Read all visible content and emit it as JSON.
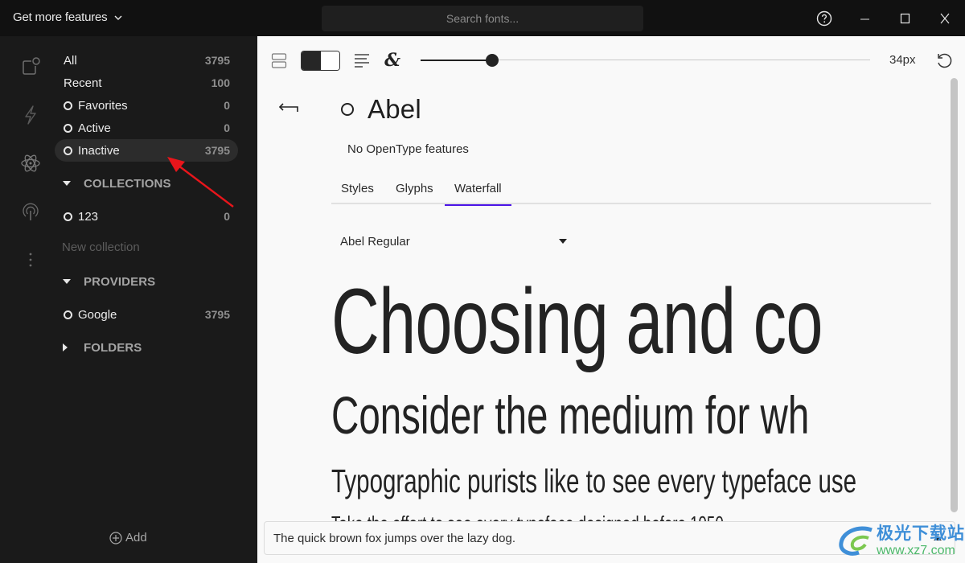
{
  "titlebar": {
    "features_label": "Get more features",
    "search_placeholder": "Search fonts...",
    "help_icon": "question-circle-icon",
    "minimize_icon": "minimize-icon",
    "maximize_icon": "maximize-icon",
    "close_icon": "close-icon"
  },
  "rail": {
    "items": [
      {
        "icon": "shapes-icon"
      },
      {
        "icon": "lightning-icon"
      },
      {
        "icon": "atom-icon"
      },
      {
        "icon": "broadcast-icon"
      },
      {
        "icon": "more-vertical-icon"
      }
    ]
  },
  "sidebar": {
    "library": [
      {
        "label": "All",
        "count": "3795",
        "has_ring": false
      },
      {
        "label": "Recent",
        "count": "100",
        "has_ring": false
      },
      {
        "label": "Favorites",
        "count": "0",
        "has_ring": true
      },
      {
        "label": "Active",
        "count": "0",
        "has_ring": true
      },
      {
        "label": "Inactive",
        "count": "3795",
        "has_ring": true,
        "selected": true
      }
    ],
    "collections": {
      "header": "COLLECTIONS",
      "expanded": true,
      "items": [
        {
          "label": "123",
          "count": "0"
        }
      ],
      "new_placeholder": "New collection"
    },
    "providers": {
      "header": "PROVIDERS",
      "expanded": true,
      "items": [
        {
          "label": "Google",
          "count": "3795"
        }
      ]
    },
    "folders": {
      "header": "FOLDERS",
      "expanded": false
    },
    "add_label": "Add"
  },
  "toolbar": {
    "layout_icon": "layout-rows-icon",
    "theme_toggle": "dark-light-toggle",
    "align_icon": "align-left-icon",
    "opentype_icon": "ampersand-icon",
    "size_slider_fraction": 0.16,
    "size_readout": "34px",
    "reset_icon": "reset-icon"
  },
  "font": {
    "name": "Abel",
    "opentype_note": "No OpenType features",
    "tabs": [
      {
        "label": "Styles",
        "active": false
      },
      {
        "label": "Glyphs",
        "active": false
      },
      {
        "label": "Waterfall",
        "active": true
      }
    ],
    "style_select": "Abel Regular",
    "waterfall": [
      "Choosing and co",
      "Consider the medium for wh",
      "Typographic purists like to see every typeface use",
      "Take the effort to see every typeface designed before 1950"
    ]
  },
  "preview_input": {
    "value": "The quick brown fox jumps over the lazy dog."
  },
  "watermark": {
    "cn": "极光下载站",
    "url": "www.xz7.com"
  },
  "colors": {
    "accent": "#4b14e6",
    "sidebar_bg": "#1a1a1a",
    "titlebar_bg": "#111111",
    "main_bg": "#f9f9f9",
    "annotation": "#e8151b"
  }
}
